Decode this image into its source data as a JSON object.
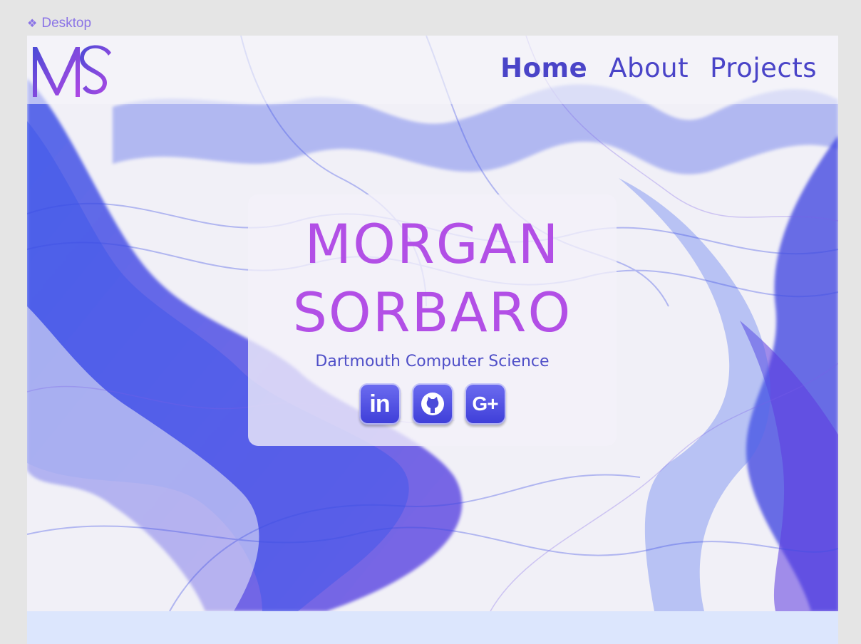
{
  "frame": {
    "label": "Desktop",
    "icon": "diamond-icon"
  },
  "logo": {
    "text": "MS",
    "colors": [
      "#4b4bd6",
      "#b048e4"
    ]
  },
  "nav": {
    "items": [
      {
        "label": "Home",
        "active": true
      },
      {
        "label": "About",
        "active": false
      },
      {
        "label": "Projects",
        "active": false
      }
    ]
  },
  "hero": {
    "first_name": "MORGAN",
    "last_name": "SORBARO",
    "subtitle": "Dartmouth Computer Science",
    "socials": [
      {
        "name": "linkedin",
        "glyph": "in"
      },
      {
        "name": "github",
        "glyph": "github"
      },
      {
        "name": "google-plus",
        "glyph": "G+"
      }
    ]
  },
  "colors": {
    "accent_purple": "#b24fe6",
    "nav_blue": "#4a44c8",
    "flow_blue": "#3346e0",
    "footer_band": "#dce6fd"
  }
}
